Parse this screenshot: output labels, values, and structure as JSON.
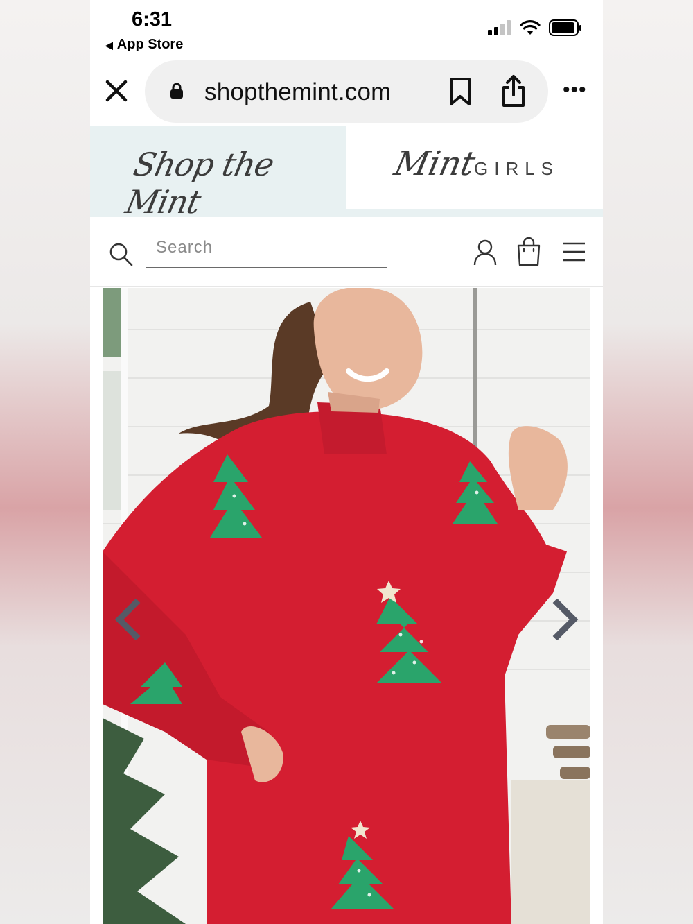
{
  "status_bar": {
    "time": "6:31",
    "back_label": "App Store",
    "icons": [
      "cellular-signal-icon",
      "wifi-icon",
      "battery-icon"
    ]
  },
  "browser": {
    "domain": "shopthemint.com",
    "icons": [
      "close-icon",
      "lock-icon",
      "bookmark-icon",
      "share-icon",
      "more-icon"
    ],
    "more_label": "•••"
  },
  "brand_tabs": [
    {
      "label": "Shop the Mint",
      "active": true
    },
    {
      "label_script": "Mint",
      "label_caps": "GIRLS",
      "active": false
    }
  ],
  "header": {
    "search": {
      "placeholder": "Search",
      "value": ""
    },
    "icons": [
      "search-icon",
      "account-icon",
      "shopping-bag-icon",
      "menu-icon"
    ]
  },
  "gallery": {
    "description_icon": "product-photo",
    "prev_icon": "chevron-left-icon",
    "next_icon": "chevron-right-icon"
  },
  "colors": {
    "brand_mint": "#e8f1f2",
    "sweater_red": "#d41e31",
    "tree_green": "#2aa46b",
    "arrow_gray": "#555a66"
  }
}
